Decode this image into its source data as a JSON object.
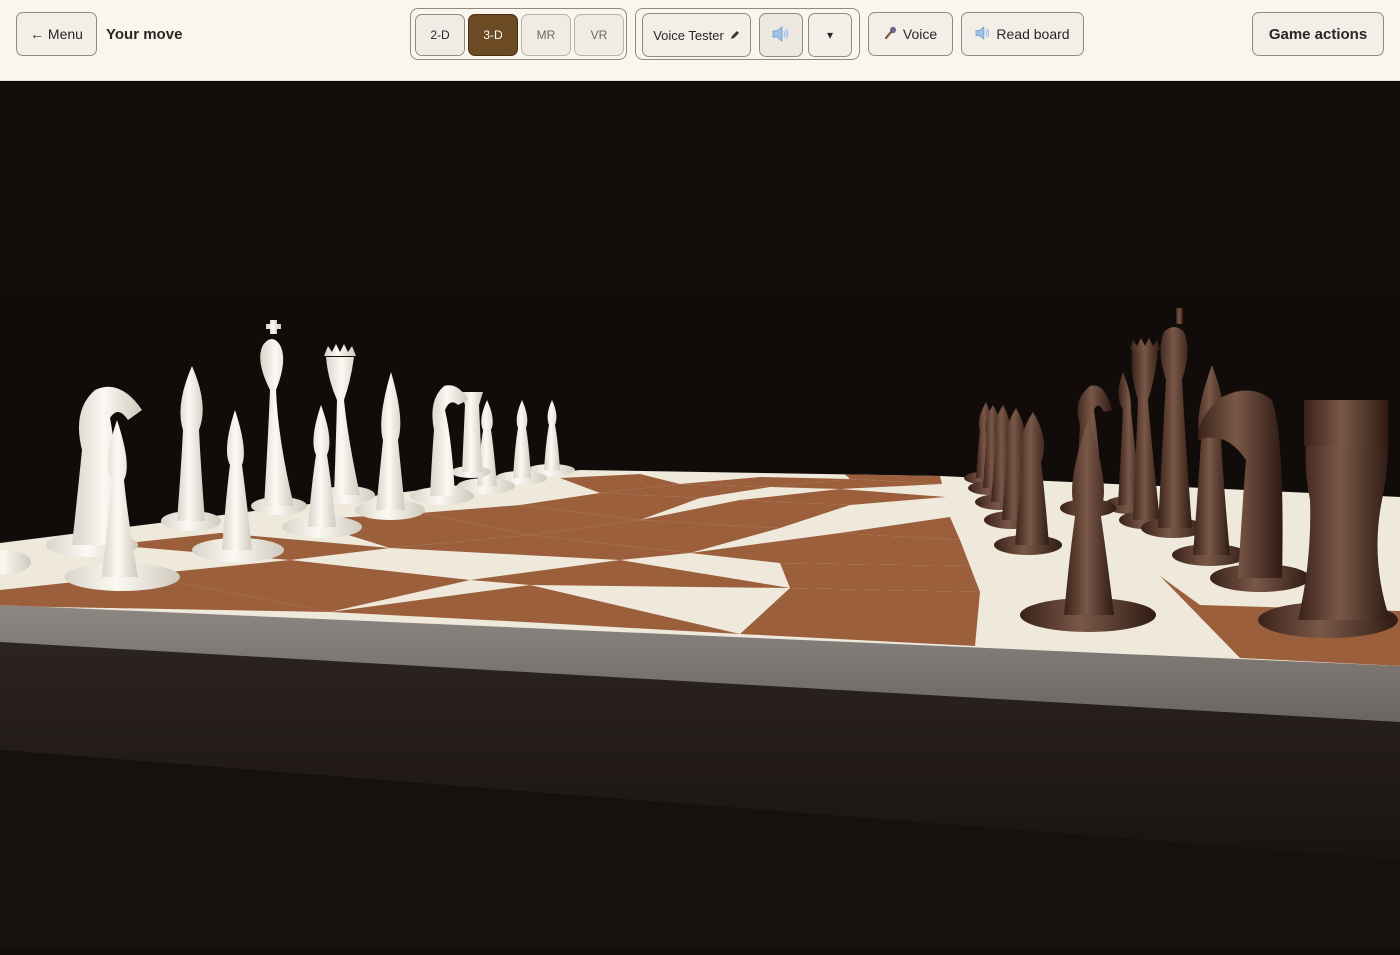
{
  "header": {
    "menu_label": "← Menu",
    "status": "Your move",
    "view_modes": [
      {
        "label": "2-D",
        "active": false
      },
      {
        "label": "3-D",
        "active": true
      },
      {
        "label": "MR",
        "active": false
      },
      {
        "label": "VR",
        "active": false
      }
    ],
    "voice_selector_label": "Voice Tester",
    "voice_edit_icon": "pencil-icon",
    "volume_icon": "speaker-icon",
    "dropdown_icon": "caret-down-icon",
    "dropdown_glyph": "▾",
    "voice_button_label": "Voice",
    "voice_button_icon": "microphone-icon",
    "read_board_label": "Read board",
    "read_board_icon": "speaker-icon",
    "game_actions_label": "Game actions"
  },
  "colors": {
    "active_mode": "#6b4a24",
    "board_light": "#efe9dc",
    "board_dark": "#9c5f3c",
    "white_pieces": "#f2efe7",
    "black_pieces": "#4e2f22",
    "background": "#110d0b"
  }
}
